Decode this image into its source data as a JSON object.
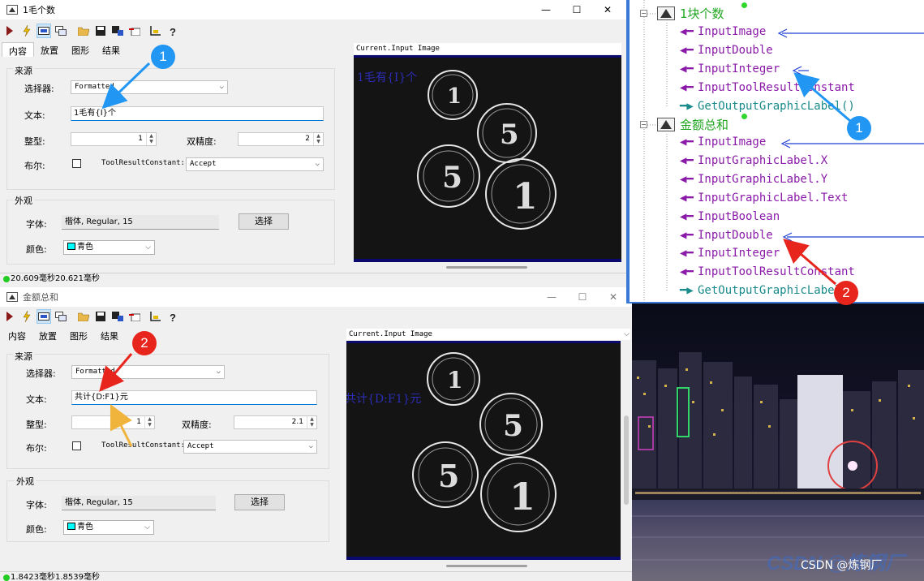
{
  "window1": {
    "title": "1毛个数",
    "controls": {
      "minimize": "—",
      "maximize": "☐",
      "close": "✕"
    },
    "tabs": [
      "内容",
      "放置",
      "图形",
      "结果"
    ],
    "source_group": "来源",
    "selector_label": "选择器:",
    "selector_value": "Formatted",
    "text_label": "文本:",
    "text_value": "1毛有{I}个",
    "int_label": "整型:",
    "int_value": "1",
    "double_label": "双精度:",
    "double_value": "2",
    "bool_label": "布尔:",
    "trc_label": "ToolResultConstant:",
    "trc_value": "Accept",
    "appearance_group": "外观",
    "font_label": "字体:",
    "font_value": "楷体, Regular, 15",
    "choose_button": "选择",
    "color_label": "颜色:",
    "color_value": "青色",
    "image_title": "Current.Input Image",
    "image_overlay_text": "1毛有{I}个",
    "status": "20.609毫秒20.621毫秒"
  },
  "window2": {
    "title": "金额总和",
    "controls": {
      "minimize": "—",
      "maximize": "☐",
      "close": "✕"
    },
    "tabs": [
      "内容",
      "放置",
      "图形",
      "结果"
    ],
    "source_group": "来源",
    "selector_label": "选择器:",
    "selector_value": "Formatted",
    "text_label": "文本:",
    "text_value": "共计{D:F1}元",
    "int_label": "整型:",
    "int_value": "1",
    "double_label": "双精度:",
    "double_value": "2.1",
    "bool_label": "布尔:",
    "trc_label": "ToolResultConstant:",
    "trc_value": "Accept",
    "appearance_group": "外观",
    "font_label": "字体:",
    "font_value": "楷体, Regular, 15",
    "choose_button": "选择",
    "color_label": "颜色:",
    "color_value": "青色",
    "image_title": "Current.Input Image",
    "image_overlay_text": "共计{D:F1}元",
    "status": "1.8423毫秒1.8539毫秒"
  },
  "tree": {
    "group1": "1块个数",
    "group1_items": [
      {
        "label": "InputImage",
        "kind": "in"
      },
      {
        "label": "InputDouble",
        "kind": "in"
      },
      {
        "label": "InputInteger",
        "kind": "in"
      },
      {
        "label": "InputToolResultConstant",
        "kind": "in"
      },
      {
        "label": "GetOutputGraphicLabel()",
        "kind": "out"
      }
    ],
    "group2": "金额总和",
    "group2_items": [
      {
        "label": "InputImage",
        "kind": "in"
      },
      {
        "label": "InputGraphicLabel.X",
        "kind": "in"
      },
      {
        "label": "InputGraphicLabel.Y",
        "kind": "in"
      },
      {
        "label": "InputGraphicLabel.Text",
        "kind": "in"
      },
      {
        "label": "InputBoolean",
        "kind": "in"
      },
      {
        "label": "InputDouble",
        "kind": "in"
      },
      {
        "label": "InputInteger",
        "kind": "in"
      },
      {
        "label": "InputToolResultConstant",
        "kind": "in"
      },
      {
        "label": "GetOutputGraphicLabel()",
        "kind": "out"
      }
    ]
  },
  "badges": {
    "one": "1",
    "two": "2"
  },
  "watermark": "CSDN @炼钢厂",
  "colors": {
    "accent_blue": "#2196f3",
    "accent_red": "#e8251c",
    "link_line": "#1f3fd6",
    "tree_input": "#8a1aa8",
    "tree_output": "#1a8a8a",
    "tree_group": "#22a622"
  }
}
